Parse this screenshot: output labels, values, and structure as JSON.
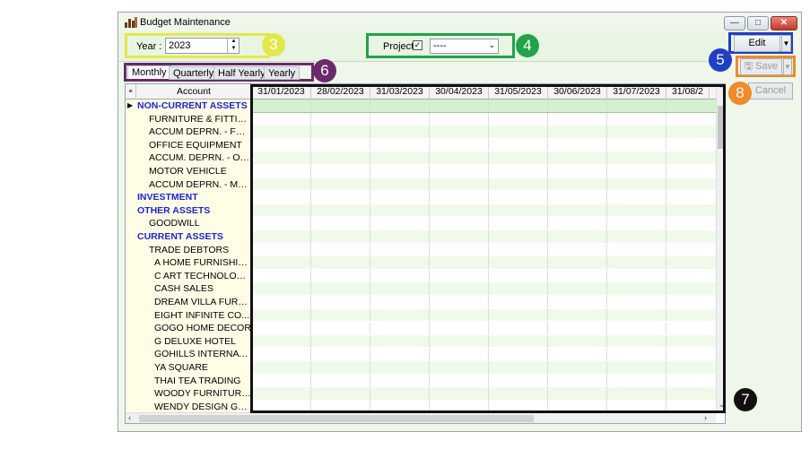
{
  "window": {
    "title": "Budget Maintenance",
    "controls": {
      "minimize": "—",
      "maximize": "□",
      "close": "✕"
    }
  },
  "toolbar": {
    "year_label": "Year :",
    "year_value": "2023",
    "project_label": "Project",
    "project_checked": "✓",
    "project_value": "----",
    "project_arrow": "⌄"
  },
  "tabs": [
    {
      "label": "Monthly",
      "active": true
    },
    {
      "label": "Quarterly",
      "active": false
    },
    {
      "label": "Half Yearly",
      "active": false
    },
    {
      "label": "Yearly",
      "active": false
    }
  ],
  "grid": {
    "account_header": "Account",
    "columns": [
      "31/01/2023",
      "28/02/2023",
      "31/03/2023",
      "30/04/2023",
      "31/05/2023",
      "30/06/2023",
      "31/07/2023",
      "31/08/2"
    ],
    "rows": [
      {
        "label": "NON-CURRENT ASSETS",
        "group": true,
        "indent": 0
      },
      {
        "label": "FURNITURE & FITTINGS",
        "group": false,
        "indent": 1
      },
      {
        "label": "ACCUM DEPRN. - FUR...",
        "group": false,
        "indent": 1
      },
      {
        "label": "OFFICE EQUIPMENT",
        "group": false,
        "indent": 1
      },
      {
        "label": "ACCUM. DEPRN. - OFF...",
        "group": false,
        "indent": 1
      },
      {
        "label": "MOTOR VEHICLE",
        "group": false,
        "indent": 1
      },
      {
        "label": "ACCUM DEPRN. - MOT...",
        "group": false,
        "indent": 1
      },
      {
        "label": "INVESTMENT",
        "group": true,
        "indent": 0
      },
      {
        "label": "OTHER ASSETS",
        "group": true,
        "indent": 0
      },
      {
        "label": "GOODWILL",
        "group": false,
        "indent": 1
      },
      {
        "label": "CURRENT ASSETS",
        "group": true,
        "indent": 0
      },
      {
        "label": "TRADE DEBTORS",
        "group": false,
        "indent": 1
      },
      {
        "label": "A HOME FURNISHIN...",
        "group": false,
        "indent": 2
      },
      {
        "label": "C ART TECHNOLOGY...",
        "group": false,
        "indent": 2
      },
      {
        "label": "CASH SALES",
        "group": false,
        "indent": 2
      },
      {
        "label": "DREAM VILLA FURNI...",
        "group": false,
        "indent": 2
      },
      {
        "label": "EIGHT INFINITE CO...",
        "group": false,
        "indent": 2
      },
      {
        "label": "GOGO HOME DECOR",
        "group": false,
        "indent": 2
      },
      {
        "label": "G DELUXE HOTEL",
        "group": false,
        "indent": 2
      },
      {
        "label": "GOHILLS INTERNATI...",
        "group": false,
        "indent": 2
      },
      {
        "label": "YA SQUARE",
        "group": false,
        "indent": 2
      },
      {
        "label": "THAI TEA TRADING",
        "group": false,
        "indent": 2
      },
      {
        "label": "WOODY FURNITURE...",
        "group": false,
        "indent": 2
      },
      {
        "label": "WENDY DESIGN GRO...",
        "group": false,
        "indent": 2
      }
    ]
  },
  "actions": {
    "edit": "Edit",
    "save": "Save",
    "cancel": "Cancel"
  },
  "annotations": {
    "a3": "3",
    "a4": "4",
    "a5": "5",
    "a6": "6",
    "a7": "7",
    "a8": "8"
  },
  "colors": {
    "yellow": "#e3e84a",
    "green": "#22a34a",
    "blue": "#1f3fc4",
    "purple": "#6b2a6b",
    "orange": "#f08a2a",
    "black": "#111111",
    "group_text": "#1c25d8"
  }
}
